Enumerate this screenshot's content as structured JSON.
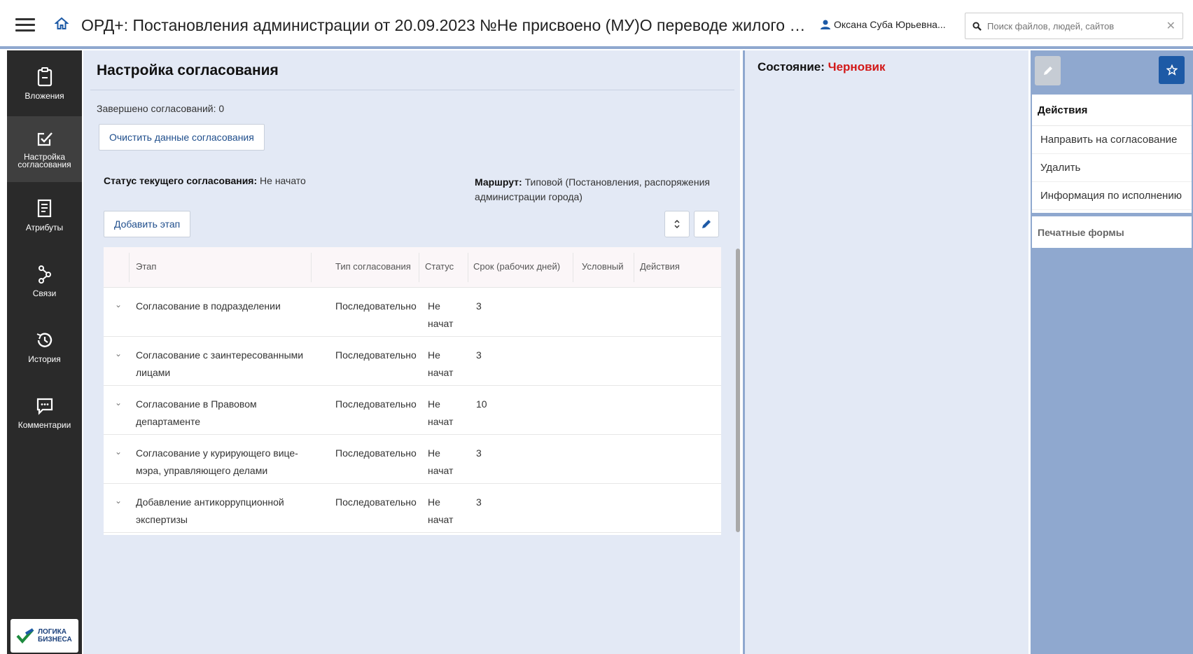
{
  "header": {
    "title": "ОРД+: Постановления администрации от 20.09.2023 №Не присвоено (МУ)О переводе жилого по...",
    "user": "Оксана Суба Юрьевна...",
    "search_placeholder": "Поиск файлов, людей, сайтов"
  },
  "sidebar": {
    "items": [
      {
        "label": "Вложения",
        "icon": "clipboard-icon"
      },
      {
        "label": "Настройка согласования",
        "icon": "checkmark-edit-icon"
      },
      {
        "label": "Атрибуты",
        "icon": "document-list-icon"
      },
      {
        "label": "Связи",
        "icon": "link-nodes-icon"
      },
      {
        "label": "История",
        "icon": "history-icon"
      },
      {
        "label": "Комментарии",
        "icon": "comment-icon"
      }
    ],
    "logo_line1": "ЛОГИКА",
    "logo_line2": "БИЗНЕСА"
  },
  "main": {
    "title": "Настройка согласования",
    "completed": "Завершено согласований: 0",
    "clear_button": "Очистить данные согласования",
    "status_label": "Статус текущего согласования:",
    "status_value": " Не начато",
    "route_label": "Маршрут:",
    "route_value": " Типовой (Постановления, распоряжения администрации города)",
    "add_stage_button": "Добавить этап",
    "table": {
      "columns": [
        "Этап",
        "Тип согласования",
        "Статус",
        "Срок (рабочих дней)",
        "Условный",
        "Действия"
      ],
      "rows": [
        {
          "stage": "Согласование в подразделении",
          "type": "Последовательно",
          "status": "Не начат",
          "term": "3"
        },
        {
          "stage": "Согласование с заинтересованными лицами",
          "type": "Последовательно",
          "status": "Не начат",
          "term": "3"
        },
        {
          "stage": "Согласование в Правовом департаменте",
          "type": "Последовательно",
          "status": "Не начат",
          "term": "10"
        },
        {
          "stage": "Согласование у курирующего вице-мэра, управляющего делами",
          "type": "Последовательно",
          "status": "Не начат",
          "term": "3"
        },
        {
          "stage": "Добавление антикоррупционной экспертизы",
          "type": "Последовательно",
          "status": "Не начат",
          "term": "3"
        }
      ]
    }
  },
  "state": {
    "label": "Состояние: ",
    "value": "Черновик",
    "value_color": "#d21919"
  },
  "actions": {
    "header": "Действия",
    "items": [
      "Направить на согласование",
      "Удалить",
      "Информация по исполнению"
    ],
    "print_forms": "Печатные формы"
  },
  "colors": {
    "accent": "#1d5aa6",
    "panel_bg": "#e3e9f5",
    "side_bg": "#8fa8cf",
    "nav_bg": "#2a2a2a"
  }
}
